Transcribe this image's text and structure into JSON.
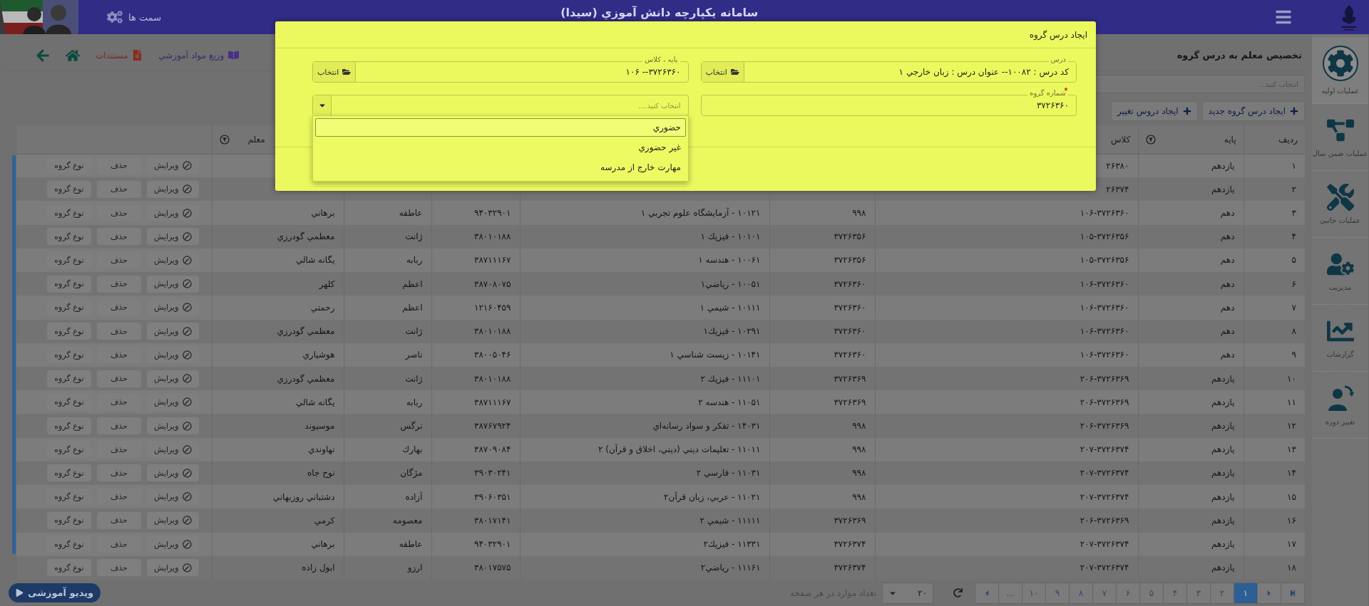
{
  "header": {
    "title": "سامانه يکپارچه دانش آموزي (سيدا)",
    "roles": "سمت ها"
  },
  "page": {
    "title": "تخصیص معلم به درس گروه",
    "links": [
      {
        "kind": "book",
        "label": "وزیع مواد آموزشي"
      },
      {
        "kind": "docs",
        "label": "مستندات"
      }
    ]
  },
  "filter": {
    "placeholder": "انتخاب كنيد..."
  },
  "toolbar": [
    {
      "label": "ایجاد درس گروه جدید"
    },
    {
      "label": "ایجاد دروس تغییر"
    }
  ],
  "table": {
    "columns": [
      {
        "label": "ردیف"
      },
      {
        "label": "پایه",
        "filter": true
      },
      {
        "label": "کلاس"
      },
      {},
      {},
      {},
      {},
      {
        "label": "معلم",
        "filter": true
      },
      {}
    ],
    "rows": [
      {
        "cells": [
          "۱",
          "یازدهم",
          "۲۶۳۸۰"
        ],
        "actions": [
          {
            "kind": "edit",
            "label": "ویرایش"
          },
          {
            "kind": "delete",
            "label": "حذف"
          },
          {
            "kind": "type",
            "label": "نوع گروه"
          }
        ]
      },
      {
        "cells": [
          "۲",
          "یازدهم",
          "۲۶۳۷۴"
        ],
        "actions": [
          {
            "kind": "edit",
            "label": "ویرایش"
          },
          {
            "kind": "delete",
            "label": "حذف"
          },
          {
            "kind": "type",
            "label": "نوع گروه"
          }
        ]
      },
      {
        "cells": [
          "۳",
          "دهم",
          "۱۰۶-۳۷۲۶۳۶۰",
          "۹۹۸",
          "۱۰۱۲۱ - آزمایشگاه علوم تجربي ۱",
          "۹۴۰۳۲۹۰۱",
          "عاطفه",
          "برهاني"
        ],
        "actions": [
          {
            "kind": "edit",
            "label": "ویرایش"
          },
          {
            "kind": "delete",
            "label": "حذف"
          },
          {
            "kind": "type",
            "label": "نوع گروه"
          }
        ]
      },
      {
        "cells": [
          "۴",
          "دهم",
          "۱۰۵-۳۷۲۶۳۵۶",
          "۳۷۲۶۳۵۶",
          "۱۰۱۰۱ - فیزیك ۱",
          "۳۸۰۱۰۱۸۸",
          "ژانت",
          "معظمي گودرزي"
        ],
        "actions": [
          {
            "kind": "edit",
            "label": "ویرایش"
          },
          {
            "kind": "delete",
            "label": "حذف"
          },
          {
            "kind": "type",
            "label": "نوع گروه"
          }
        ]
      },
      {
        "cells": [
          "۵",
          "دهم",
          "۱۰۵-۳۷۲۶۳۵۶",
          "۳۷۲۶۳۵۶",
          "۱۰۰۶۱ - هندسه ۱",
          "۳۸۷۱۱۱۶۷",
          "ربابه",
          "يگانه شالي"
        ],
        "actions": [
          {
            "kind": "edit",
            "label": "ویرایش"
          },
          {
            "kind": "delete",
            "label": "حذف"
          },
          {
            "kind": "type",
            "label": "نوع گروه"
          }
        ]
      },
      {
        "cells": [
          "۶",
          "دهم",
          "۱۰۶-۳۷۲۶۳۶۰",
          "۳۷۲۶۳۶۰",
          "۱۰۰۵۱ - رياضي۱",
          "۳۸۷۰۸۰۷۵",
          "اعظم",
          "كلهر"
        ],
        "actions": [
          {
            "kind": "edit",
            "label": "ویرایش"
          },
          {
            "kind": "delete",
            "label": "حذف"
          },
          {
            "kind": "type",
            "label": "نوع گروه"
          }
        ]
      },
      {
        "cells": [
          "۷",
          "دهم",
          "۱۰۶-۳۷۲۶۳۶۰",
          "۳۷۲۶۳۶۰",
          "۱۰۱۱۱ - شيمي ۱",
          "۱۲۱۶۰۴۵۹",
          "اعظم",
          "رحمتي"
        ],
        "actions": [
          {
            "kind": "edit",
            "label": "ویرایش"
          },
          {
            "kind": "delete",
            "label": "حذف"
          },
          {
            "kind": "type",
            "label": "نوع گروه"
          }
        ]
      },
      {
        "cells": [
          "۸",
          "دهم",
          "۱۰۶-۳۷۲۶۳۶۰",
          "۳۷۲۶۳۶۰",
          "۱۰۲۹۱ - فیزیك۱",
          "۳۸۰۱۰۱۸۸",
          "ژانت",
          "معظمي گودرزي"
        ],
        "actions": [
          {
            "kind": "edit",
            "label": "ویرایش"
          },
          {
            "kind": "delete",
            "label": "حذف"
          },
          {
            "kind": "type",
            "label": "نوع گروه"
          }
        ]
      },
      {
        "cells": [
          "۹",
          "دهم",
          "۱۰۶-۳۷۲۶۳۶۰",
          "۳۷۲۶۳۶۰",
          "۱۰۱۴۱ - زيست شناسي ۱",
          "۳۸۰۰۵۰۴۶",
          "ناصر",
          "هوشياري"
        ],
        "actions": [
          {
            "kind": "edit",
            "label": "ویرایش"
          },
          {
            "kind": "delete",
            "label": "حذف"
          },
          {
            "kind": "type",
            "label": "نوع گروه"
          }
        ]
      },
      {
        "cells": [
          "۱۰",
          "یازدهم",
          "۲۰۶-۳۷۲۶۳۶۹",
          "۳۷۲۶۳۶۹",
          "۱۱۱۰۱ - فیزیك ۲",
          "۳۸۰۱۰۱۸۸",
          "ژانت",
          "معظمي گودرزي"
        ],
        "actions": [
          {
            "kind": "edit",
            "label": "ویرایش"
          },
          {
            "kind": "delete",
            "label": "حذف"
          },
          {
            "kind": "type",
            "label": "نوع گروه"
          }
        ]
      },
      {
        "cells": [
          "۱۱",
          "یازدهم",
          "۲۰۶-۳۷۲۶۳۶۹",
          "۳۷۲۶۳۶۹",
          "۱۱۰۵۱ - هندسه ۲",
          "۳۸۷۱۱۱۶۷",
          "ربابه",
          "يگانه شالي"
        ],
        "actions": [
          {
            "kind": "edit",
            "label": "ویرایش"
          },
          {
            "kind": "delete",
            "label": "حذف"
          },
          {
            "kind": "type",
            "label": "نوع گروه"
          }
        ]
      },
      {
        "cells": [
          "۱۲",
          "یازدهم",
          "۲۰۶-۳۷۲۶۳۶۹",
          "۹۹۸",
          "۱۴۰۳۱ - تفكر و سواد رسانه‌اي",
          "۳۸۷۶۷۹۲۴",
          "نرگس",
          "موسيوند"
        ],
        "actions": [
          {
            "kind": "edit",
            "label": "ویرایش"
          },
          {
            "kind": "delete",
            "label": "حذف"
          },
          {
            "kind": "type",
            "label": "نوع گروه"
          }
        ]
      },
      {
        "cells": [
          "۱۳",
          "یازدهم",
          "۲۰۷-۳۷۲۶۳۷۴",
          "۹۹۸",
          "۱۱۰۱۱ - تعليمات ديني (ديني، اخلاق و قرآن) ۲",
          "۳۸۷۰۹۰۸۴",
          "بهارك",
          "نهاوندي"
        ],
        "actions": [
          {
            "kind": "edit",
            "label": "ویرایش"
          },
          {
            "kind": "delete",
            "label": "حذف"
          },
          {
            "kind": "type",
            "label": "نوع گروه"
          }
        ]
      },
      {
        "cells": [
          "۱۴",
          "یازدهم",
          "۲۰۷-۳۷۲۶۳۷۴",
          "۹۹۸",
          "۱۱۰۳۱ - فارسي ۲",
          "۳۹۰۳۰۲۴۱",
          "مژگان",
          "نوح جاه"
        ],
        "actions": [
          {
            "kind": "edit",
            "label": "ویرایش"
          },
          {
            "kind": "delete",
            "label": "حذف"
          },
          {
            "kind": "type",
            "label": "نوع گروه"
          }
        ]
      },
      {
        "cells": [
          "۱۵",
          "یازدهم",
          "۲۰۷-۳۷۲۶۳۷۴",
          "۹۹۸",
          "۱۱۰۲۱ - عربي، زبان قرآن۲",
          "۳۹۰۶۰۳۵۱",
          "آزاده",
          "دشتباني روزبهاني"
        ],
        "actions": [
          {
            "kind": "edit",
            "label": "ویرایش"
          },
          {
            "kind": "delete",
            "label": "حذف"
          },
          {
            "kind": "type",
            "label": "نوع گروه"
          }
        ]
      },
      {
        "cells": [
          "۱۶",
          "یازدهم",
          "۲۰۶-۳۷۲۶۳۶۹",
          "۳۷۲۶۳۶۹",
          "۱۱۱۱۱ - شيمي ۲",
          "۳۸۰۱۷۱۴۱",
          "معصومه",
          "كرمي"
        ],
        "actions": [
          {
            "kind": "edit",
            "label": "ویرایش"
          },
          {
            "kind": "delete",
            "label": "حذف"
          },
          {
            "kind": "type",
            "label": "نوع گروه"
          }
        ]
      },
      {
        "cells": [
          "۱۷",
          "یازدهم",
          "۲۰۷-۳۷۲۶۳۷۴",
          "۳۷۲۶۳۷۴",
          "۱۱۳۳۱ - فیزیك۲",
          "۹۴۰۳۲۹۰۱",
          "عاطفه",
          "برهاني"
        ],
        "actions": [
          {
            "kind": "edit",
            "label": "ویرایش"
          },
          {
            "kind": "delete",
            "label": "حذف"
          },
          {
            "kind": "type",
            "label": "نوع گروه"
          }
        ]
      },
      {
        "cells": [
          "۱۸",
          "یازدهم",
          "۲۰۷-۳۷۲۶۳۷۴",
          "۳۷۲۶۳۷۴",
          "۱۱۱۶۱ - رياضي۲",
          "۳۸۰۱۷۵۷۵",
          "ارزو",
          "ابول زاده"
        ],
        "actions": [
          {
            "kind": "edit",
            "label": "ویرایش"
          },
          {
            "kind": "delete",
            "label": "حذف"
          },
          {
            "kind": "type",
            "label": "نوع گروه"
          }
        ]
      }
    ]
  },
  "pagination": {
    "pages": [
      {
        "label": "۱",
        "selected": true
      },
      {
        "label": "۲",
        "selected": false
      },
      {
        "label": "۳",
        "selected": false
      },
      {
        "label": "۴",
        "selected": false
      },
      {
        "label": "۵",
        "selected": false
      },
      {
        "label": "۶",
        "selected": false
      },
      {
        "label": "۷",
        "selected": false
      },
      {
        "label": "۸",
        "selected": false
      },
      {
        "label": "۹",
        "selected": false
      },
      {
        "label": "۱۰",
        "selected": false
      }
    ],
    "ellipsis": "...",
    "page_size": "۲۰",
    "page_size_label": "تعداد موارد در هر صفحه"
  },
  "video_button": "ویدیو آموزشی",
  "sidebar": {
    "items": [
      {
        "kind": "setup",
        "label": "عملیات اولیه",
        "selected": true
      },
      {
        "kind": "yearly",
        "label": "عملیات ضمن سال",
        "selected": false
      },
      {
        "kind": "side",
        "label": "عملیات جانبی",
        "selected": false
      },
      {
        "kind": "admin",
        "label": "مدیریت",
        "selected": false
      },
      {
        "kind": "reports",
        "label": "گزارشات",
        "selected": false
      },
      {
        "kind": "period",
        "label": "تغییر دوره",
        "selected": false
      }
    ]
  },
  "modal": {
    "title": "ایجاد درس گروه",
    "fields": [
      {
        "kind": "picker",
        "label": "درس",
        "value": "کد درس : ۱۰۰۸۲-- عنوان درس : زبان خارجي ۱",
        "button": "انتخاب"
      },
      {
        "kind": "picker",
        "label": "پایه ، کلاس",
        "value": "۳۷۲۶۳۶۰-- ۱۰۶",
        "button": "انتخاب"
      },
      {
        "kind": "text",
        "label": "شماره گروه",
        "value": "۳۷۲۶۳۶۰",
        "required": true
      },
      {
        "kind": "select",
        "placeholder": "انتخاب كنيد....",
        "expanded": true,
        "options": [
          {
            "label": "حضوري",
            "selected": true
          },
          {
            "label": "غير حضوري",
            "selected": false
          },
          {
            "label": "مهارت خارج از مدرسه",
            "selected": false
          }
        ]
      }
    ]
  }
}
